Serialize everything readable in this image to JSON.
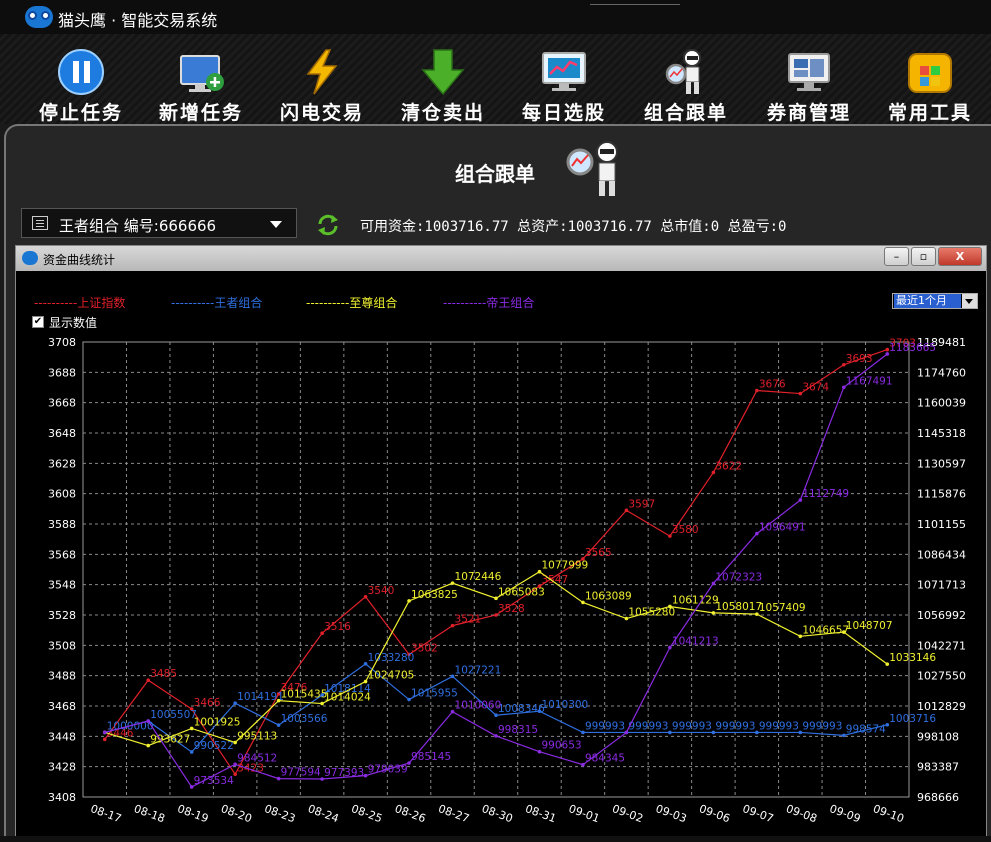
{
  "app": {
    "title": "猫头鹰 · 智能交易系统"
  },
  "toolbar": [
    {
      "label": "停止任务",
      "icon": "pause-icon"
    },
    {
      "label": "新增任务",
      "icon": "add-monitor-icon"
    },
    {
      "label": "闪电交易",
      "icon": "lightning-icon"
    },
    {
      "label": "清仓卖出",
      "icon": "down-arrow-icon"
    },
    {
      "label": "每日选股",
      "icon": "chart-monitor-icon"
    },
    {
      "label": "组合跟单",
      "icon": "magnifier-robot-icon"
    },
    {
      "label": "券商管理",
      "icon": "windows-icon"
    },
    {
      "label": "常用工具",
      "icon": "toolbox-icon"
    }
  ],
  "panel": {
    "title": "组合跟单",
    "combo_value": "王者组合  编号:666666",
    "stats": "可用资金:1003716.77 总资产:1003716.77 总市值:0 总盈亏:0"
  },
  "window": {
    "title": "资金曲线统计",
    "minimize": "–",
    "restore": "▫",
    "close": "X",
    "period": "最近1个月",
    "show_values_label": "显示数值",
    "show_values_checked": true
  },
  "colors": {
    "shanghai": "#e0202a",
    "wangzhe": "#2f6fe0",
    "zhizun": "#f0f030",
    "diwang": "#8a2be2",
    "grid": "#8a8a8a"
  },
  "chart_data": {
    "type": "line",
    "categories": [
      "08-17",
      "08-18",
      "08-19",
      "08-20",
      "08-23",
      "08-24",
      "08-25",
      "08-26",
      "08-27",
      "08-30",
      "08-31",
      "09-01",
      "09-02",
      "09-03",
      "09-06",
      "09-07",
      "09-08",
      "09-09",
      "09-10"
    ],
    "y_left": {
      "ticks": [
        3408,
        3428,
        3448,
        3468,
        3488,
        3508,
        3528,
        3548,
        3568,
        3588,
        3608,
        3628,
        3648,
        3668,
        3688,
        3708
      ],
      "range": [
        3408,
        3708
      ]
    },
    "y_right": {
      "ticks": [
        968666,
        983387,
        998108,
        1012829,
        1027550,
        1042271,
        1056992,
        1071713,
        1086434,
        1101155,
        1115876,
        1130597,
        1145318,
        1160039,
        1174760,
        1189481
      ],
      "range": [
        968666,
        1189481
      ]
    },
    "grid": true,
    "legend_position": "top-left",
    "series": [
      {
        "name": "上证指数",
        "axis": "left",
        "legend_prefix": "----------",
        "values": [
          3446,
          3485,
          3466,
          3423,
          3476,
          3516,
          3540,
          3502,
          3521,
          3528,
          3547,
          3565,
          3597,
          3580,
          3622,
          3676,
          3674,
          3693,
          3703
        ]
      },
      {
        "name": "王者组合",
        "axis": "right",
        "legend_prefix": "----------",
        "values": [
          1000000,
          1005507,
          990522,
          1014191,
          1003566,
          1018114,
          1033280,
          1015955,
          1027221,
          1008346,
          1010300,
          999993,
          999993,
          999993,
          999993,
          999993,
          999993,
          998574,
          1003716
        ]
      },
      {
        "name": "至尊组合",
        "axis": "right",
        "legend_prefix": "----------",
        "values": [
          1000000,
          993627,
          1001925,
          995113,
          1015435,
          1014024,
          1024705,
          1063825,
          1072446,
          1065083,
          1077999,
          1063089,
          1055280,
          1061129,
          1058017,
          1057409,
          1046657,
          1048707,
          1033146
        ]
      },
      {
        "name": "帝王组合",
        "axis": "right",
        "legend_prefix": "----------",
        "values": [
          1000000,
          1005507,
          973534,
          984512,
          977594,
          977393,
          979039,
          985145,
          1010060,
          998315,
          990653,
          984345,
          999993,
          1041213,
          1072323,
          1096491,
          1112749,
          1167491,
          1183665
        ]
      }
    ],
    "point_labels": {
      "上证指数": [
        "3446",
        "3485",
        "3466",
        "3423",
        "3476",
        "3516",
        "3540",
        "3502",
        "3521",
        "3528",
        "3547",
        "3565",
        "3597",
        "3580",
        "3622",
        "3676",
        "3674",
        "3693",
        "3703"
      ],
      "王者组合": [
        "1000000",
        "1005507",
        "990522",
        "1014191",
        "1003566",
        "1018114",
        "1033280",
        "1015955",
        "1027221",
        "1008346",
        "1010300",
        "999993",
        "999993",
        "999993",
        "999993",
        "999993",
        "999993",
        "998574",
        "1003716"
      ],
      "至尊组合": [
        "",
        "993627",
        "1001925",
        "995113",
        "1015435",
        "1014024",
        "1024705",
        "1063825",
        "1072446",
        "1065083",
        "1077999",
        "1063089",
        "1055280",
        "1061129",
        "1058017",
        "1057409",
        "1046657",
        "1048707",
        "1033146"
      ],
      "帝王组合": [
        "",
        "",
        "973534",
        "984512",
        "977594",
        "977393",
        "979039",
        "985145",
        "1010060",
        "998315",
        "990653",
        "984345",
        "",
        "1041213",
        "1072323",
        "1096491",
        "1112749",
        "1167491",
        "1183665"
      ]
    }
  }
}
